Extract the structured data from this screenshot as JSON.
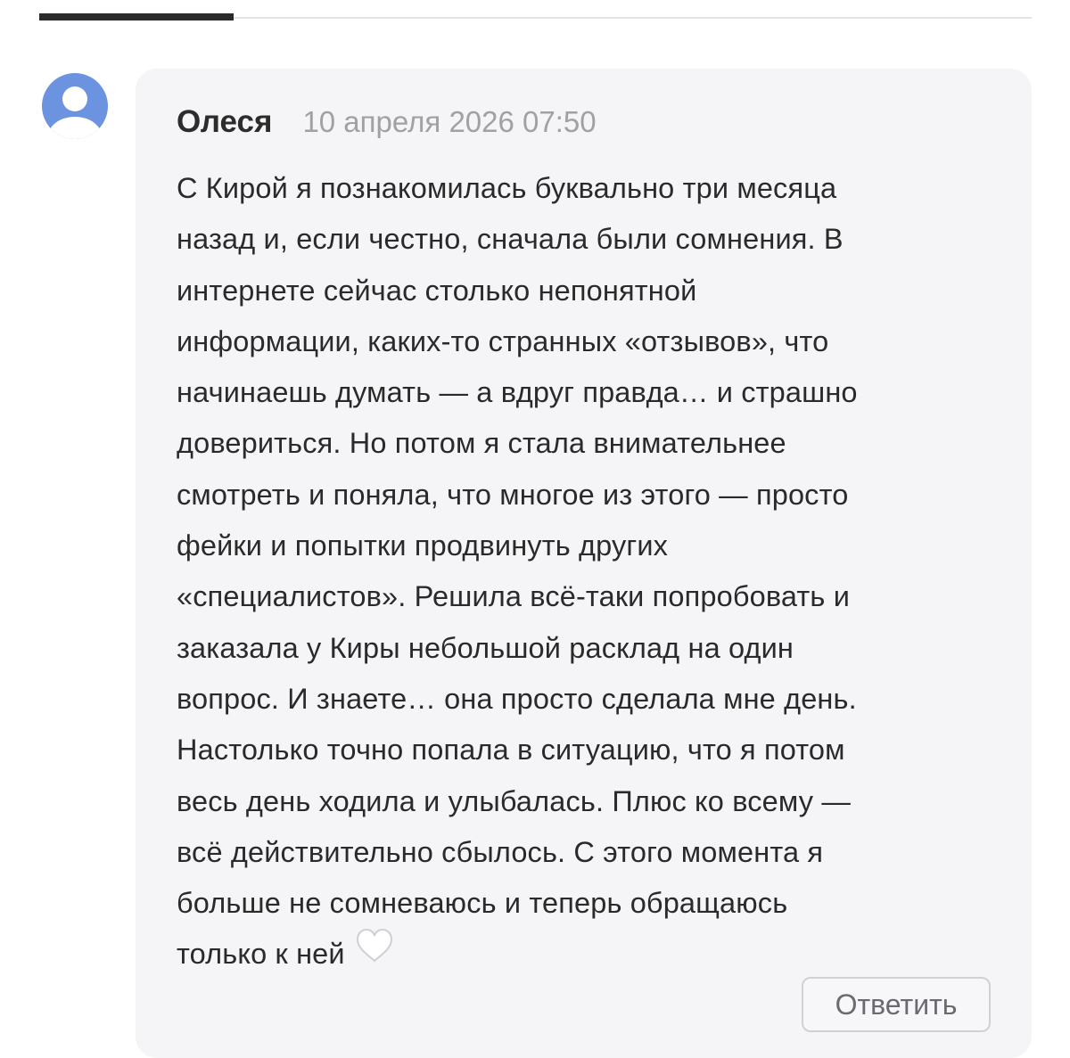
{
  "comment": {
    "author": "Олеся",
    "date": "10 апреля 2026 07:50",
    "lines": [
      "С Кирой я познакомилась буквально три месяца",
      "назад и, если честно, сначала были сомнения. В",
      "интернете сейчас столько непонятной",
      "информации, каких-то странных «отзывов», что",
      "начинаешь думать — а вдруг правда… и страшно",
      "довериться. Но потом я стала внимательнее",
      "смотреть и поняла, что многое из этого — просто",
      "фейки и попытки продвинуть других",
      "«специалистов». Решила всё-таки попробовать и",
      "заказала у Киры небольшой расклад на один",
      "вопрос. И знаете… она просто сделала мне день.",
      "Настолько точно попала в ситуацию, что я потом",
      "весь день ходила и улыбалась. Плюс ко всему —",
      "всё действительно сбылось. С этого момента я",
      "больше не сомневаюсь и теперь обращаюсь",
      "только к ней"
    ],
    "end_icon": "white-heart-icon",
    "reply_label": "Ответить"
  },
  "colors": {
    "card_background": "#f5f5f7",
    "avatar": "#6b93df",
    "date_text": "#a0a0a5",
    "active_tab": "#2a2a2a"
  }
}
